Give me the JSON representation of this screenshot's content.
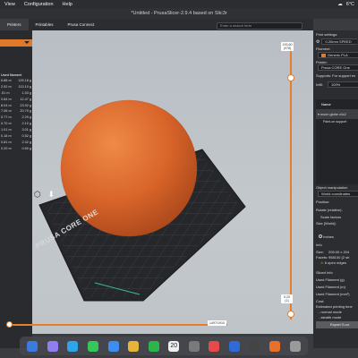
{
  "menubar": {
    "items": [
      "View",
      "Configuration",
      "Help"
    ],
    "temperature": "6°C"
  },
  "window": {
    "title": "*Untitled - PrusaSlicer-2.9.4 based on Slic3r"
  },
  "tabs": [
    "Printers",
    "Printables",
    "Prusa Connect"
  ],
  "search": {
    "placeholder": "Enter a search term"
  },
  "left_panel": {
    "header": "Used filament",
    "rows": [
      [
        "6.88 m",
        "125.18 g"
      ],
      [
        "2.92 m",
        "113.10 g"
      ],
      [
        ".51 m",
        "1.53 g"
      ],
      [
        "0.84 m",
        "12.47 g"
      ],
      [
        "8.04 m",
        "23.92 g"
      ],
      [
        "7.06 m",
        "20.79 g"
      ],
      [
        "0.77 m",
        "2.29 g"
      ],
      [
        "0.70 m",
        "2.10 g"
      ],
      [
        "1.01 m",
        "3.01 g"
      ],
      [
        "0.18 m",
        "0.52 g"
      ],
      [
        "0.81 m",
        "2.42 g"
      ],
      [
        "0.20 m",
        "0.60 g"
      ]
    ]
  },
  "vertical_slider": {
    "top_label": "193.60\n(978)",
    "bottom_label": "0.20\n(1)"
  },
  "horizontal_slider": {
    "label": "1497/1910"
  },
  "right_panel": {
    "print_settings_label": "Print settings:",
    "print_settings_value": "0.20mm SPEED",
    "filament_label": "Filament:",
    "filament_value": "Generic PLA",
    "printer_label": "Printer:",
    "printer_value": "Prusa CORE One",
    "supports_label": "Supports: For support en",
    "infill_label": "Infill:",
    "infill_value": "100%",
    "object_list_header": "Name",
    "object_name": "moon globe v4c2",
    "object_child": "Paint-on support",
    "object_manipulation": "Object manipulation",
    "world_coordinates": "World coordinates",
    "position_label": "Position:",
    "rotate_label": "Rotate (relative):",
    "scale_factors": "Scale factors",
    "size_label": "Size [World]:",
    "inches_label": "Inches",
    "info_label": "Info",
    "size_info": "Size:",
    "size_value": "205.00 x 204",
    "facets_label": "Facets:",
    "facets_value": "958100 (2 sh",
    "open_edges": "6 open edges",
    "sliced_info": "Sliced Info",
    "used_filament_g": "Used Filament (g)",
    "used_filament_m": "Used Filament (m)",
    "used_filament_mm3": "Used Filament (mm³)",
    "cost": "Cost:",
    "estimated_time": "Estimated printing time",
    "normal_mode": "- normal mode",
    "stealth_mode": "- stealth mode",
    "export_button": "Export G-co"
  },
  "bed": {
    "brand": "PRUSA CORE ONE"
  },
  "dock": {
    "calendar_day": "20"
  },
  "colors": {
    "accent": "#e07a2a",
    "ball": "#d9652a"
  }
}
